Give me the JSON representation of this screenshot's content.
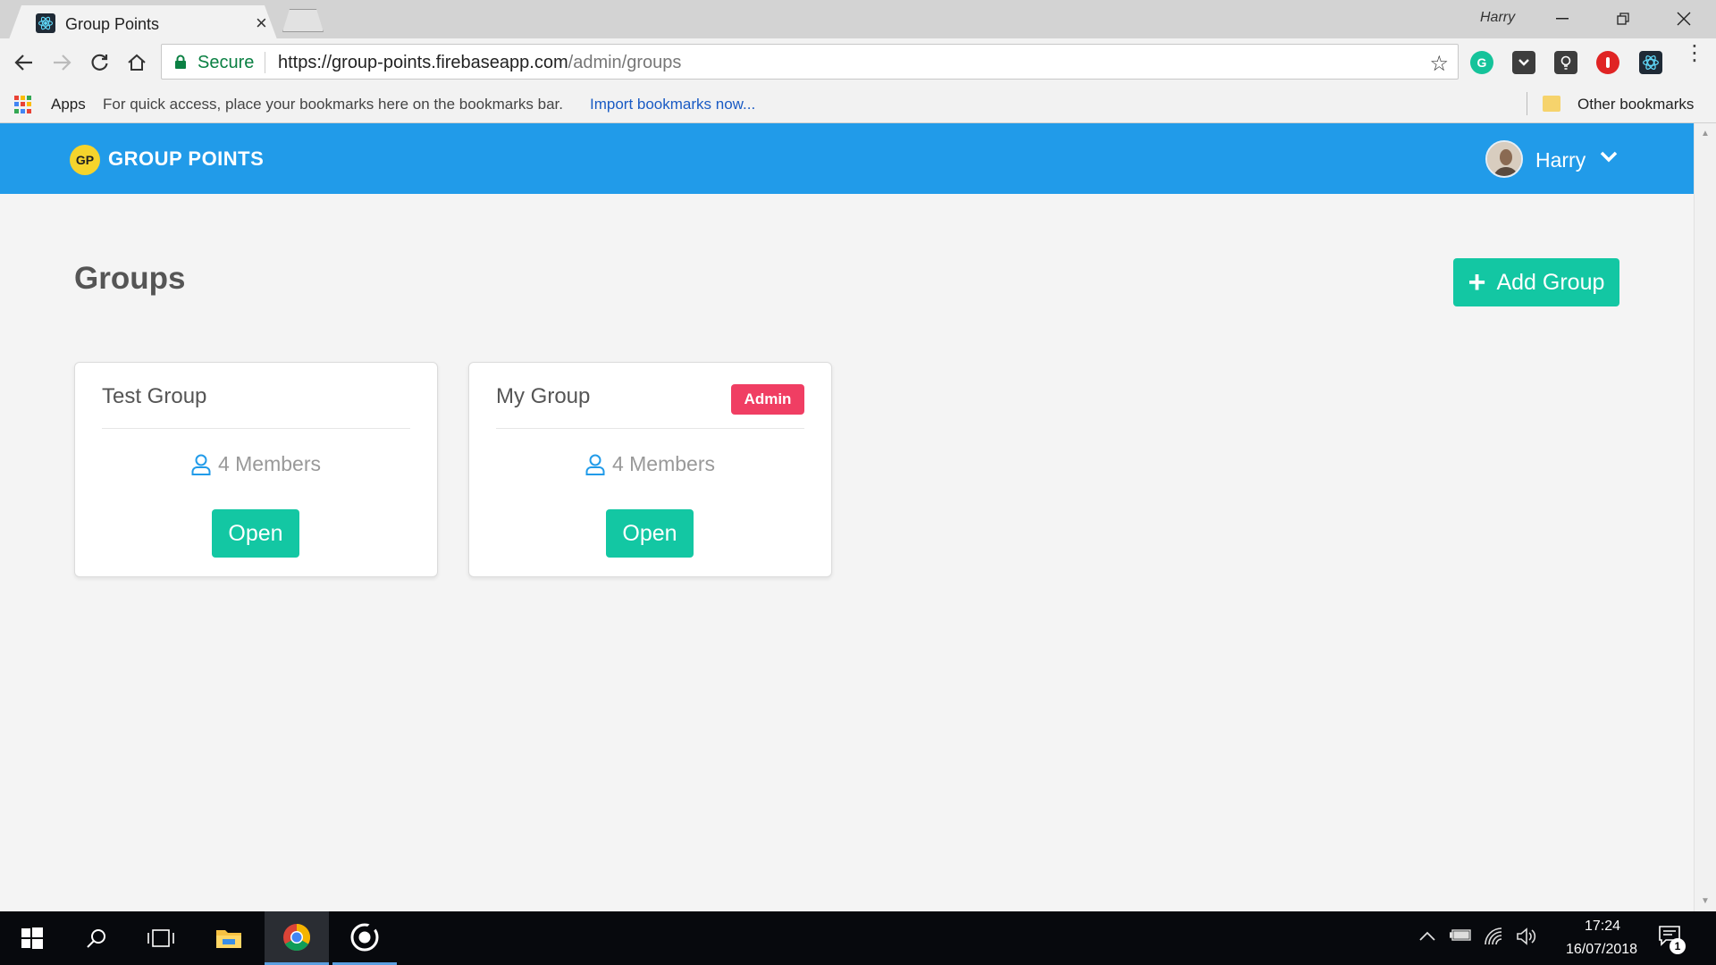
{
  "browser": {
    "tab_title": "Group Points",
    "profile_name": "Harry",
    "secure_label": "Secure",
    "url_host": "https://group-points.firebaseapp.com",
    "url_path": "/admin/groups"
  },
  "bookmarks": {
    "apps_label": "Apps",
    "hint": "For quick access, place your bookmarks here on the bookmarks bar.",
    "import_link": "Import bookmarks now...",
    "other": "Other bookmarks"
  },
  "header": {
    "logo_badge": "GP",
    "logo_text": "GROUP POINTS",
    "user_name": "Harry"
  },
  "main": {
    "title": "Groups",
    "add_button_label": "Add Group",
    "groups": [
      {
        "name": "Test Group",
        "members": "4 Members",
        "open_label": "Open"
      },
      {
        "name": "My Group",
        "badge": "Admin",
        "members": "4 Members",
        "open_label": "Open"
      }
    ]
  },
  "taskbar": {
    "time": "17:24",
    "date": "16/07/2018",
    "notifications": "1"
  },
  "colors": {
    "header": "#219be9",
    "primary_button": "#13c7a3",
    "admin_badge": "#f03e63",
    "logo_badge": "#f5d42c"
  }
}
